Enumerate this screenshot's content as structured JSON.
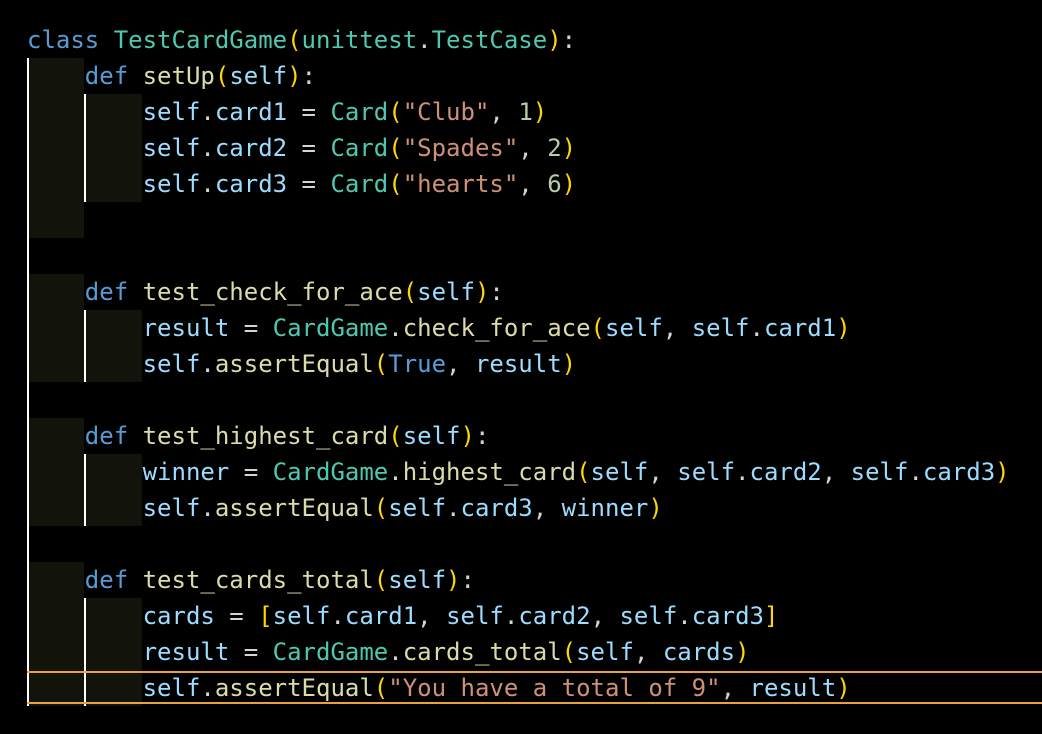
{
  "theme": {
    "background": "#000000",
    "keyword": "#569cd6",
    "class_name": "#4ec9b0",
    "function_name": "#dcdcaa",
    "variable": "#9cdcfe",
    "string": "#ce9178",
    "number": "#b5cea8",
    "bracket_level_1": "#ffd700",
    "bracket_level_2": "#da70d6",
    "bracket_level_3": "#179fff",
    "current_line_border": "#e8a33d",
    "indent_guide": "#ffffff"
  },
  "code": {
    "language": "python",
    "active_line": 20,
    "lines": [
      [
        [
          "class",
          "kw"
        ],
        [
          " ",
          "plain"
        ],
        [
          "TestCardGame",
          "cls"
        ],
        [
          "(",
          "p1"
        ],
        [
          "unittest",
          "cls"
        ],
        [
          ".",
          "plain"
        ],
        [
          "TestCase",
          "cls"
        ],
        [
          ")",
          "p1"
        ],
        [
          ":",
          "plain"
        ]
      ],
      [
        [
          "    ",
          "plain"
        ],
        [
          "def",
          "kw"
        ],
        [
          " ",
          "plain"
        ],
        [
          "setUp",
          "fn"
        ],
        [
          "(",
          "p1"
        ],
        [
          "self",
          "var"
        ],
        [
          ")",
          "p1"
        ],
        [
          ":",
          "plain"
        ]
      ],
      [
        [
          "        ",
          "plain"
        ],
        [
          "self",
          "var"
        ],
        [
          ".",
          "plain"
        ],
        [
          "card1",
          "var"
        ],
        [
          " = ",
          "plain"
        ],
        [
          "Card",
          "cls"
        ],
        [
          "(",
          "p1"
        ],
        [
          "\"Club\"",
          "str"
        ],
        [
          ", ",
          "plain"
        ],
        [
          "1",
          "num"
        ],
        [
          ")",
          "p1"
        ]
      ],
      [
        [
          "        ",
          "plain"
        ],
        [
          "self",
          "var"
        ],
        [
          ".",
          "plain"
        ],
        [
          "card2",
          "var"
        ],
        [
          " = ",
          "plain"
        ],
        [
          "Card",
          "cls"
        ],
        [
          "(",
          "p1"
        ],
        [
          "\"Spades\"",
          "str"
        ],
        [
          ", ",
          "plain"
        ],
        [
          "2",
          "num"
        ],
        [
          ")",
          "p1"
        ]
      ],
      [
        [
          "        ",
          "plain"
        ],
        [
          "self",
          "var"
        ],
        [
          ".",
          "plain"
        ],
        [
          "card3",
          "var"
        ],
        [
          " = ",
          "plain"
        ],
        [
          "Card",
          "cls"
        ],
        [
          "(",
          "p1"
        ],
        [
          "\"hearts\"",
          "str"
        ],
        [
          ", ",
          "plain"
        ],
        [
          "6",
          "num"
        ],
        [
          ")",
          "p1"
        ]
      ],
      [],
      [],
      [
        [
          "    ",
          "plain"
        ],
        [
          "def",
          "kw"
        ],
        [
          " ",
          "plain"
        ],
        [
          "test_check_for_ace",
          "fn"
        ],
        [
          "(",
          "p1"
        ],
        [
          "self",
          "var"
        ],
        [
          ")",
          "p1"
        ],
        [
          ":",
          "plain"
        ]
      ],
      [
        [
          "        ",
          "plain"
        ],
        [
          "result",
          "var"
        ],
        [
          " = ",
          "plain"
        ],
        [
          "CardGame",
          "cls"
        ],
        [
          ".",
          "plain"
        ],
        [
          "check_for_ace",
          "fn"
        ],
        [
          "(",
          "p1"
        ],
        [
          "self",
          "var"
        ],
        [
          ", ",
          "plain"
        ],
        [
          "self",
          "var"
        ],
        [
          ".",
          "plain"
        ],
        [
          "card1",
          "var"
        ],
        [
          ")",
          "p1"
        ]
      ],
      [
        [
          "        ",
          "plain"
        ],
        [
          "self",
          "var"
        ],
        [
          ".",
          "plain"
        ],
        [
          "assertEqual",
          "fn"
        ],
        [
          "(",
          "p1"
        ],
        [
          "True",
          "kw"
        ],
        [
          ", ",
          "plain"
        ],
        [
          "result",
          "var"
        ],
        [
          ")",
          "p1"
        ]
      ],
      [],
      [
        [
          "    ",
          "plain"
        ],
        [
          "def",
          "kw"
        ],
        [
          " ",
          "plain"
        ],
        [
          "test_highest_card",
          "fn"
        ],
        [
          "(",
          "p1"
        ],
        [
          "self",
          "var"
        ],
        [
          ")",
          "p1"
        ],
        [
          ":",
          "plain"
        ]
      ],
      [
        [
          "        ",
          "plain"
        ],
        [
          "winner",
          "var"
        ],
        [
          " = ",
          "plain"
        ],
        [
          "CardGame",
          "cls"
        ],
        [
          ".",
          "plain"
        ],
        [
          "highest_card",
          "fn"
        ],
        [
          "(",
          "p1"
        ],
        [
          "self",
          "var"
        ],
        [
          ", ",
          "plain"
        ],
        [
          "self",
          "var"
        ],
        [
          ".",
          "plain"
        ],
        [
          "card2",
          "var"
        ],
        [
          ", ",
          "plain"
        ],
        [
          "self",
          "var"
        ],
        [
          ".",
          "plain"
        ],
        [
          "card3",
          "var"
        ],
        [
          ")",
          "p1"
        ]
      ],
      [
        [
          "        ",
          "plain"
        ],
        [
          "self",
          "var"
        ],
        [
          ".",
          "plain"
        ],
        [
          "assertEqual",
          "fn"
        ],
        [
          "(",
          "p1"
        ],
        [
          "self",
          "var"
        ],
        [
          ".",
          "plain"
        ],
        [
          "card3",
          "var"
        ],
        [
          ", ",
          "plain"
        ],
        [
          "winner",
          "var"
        ],
        [
          ")",
          "p1"
        ]
      ],
      [],
      [
        [
          "    ",
          "plain"
        ],
        [
          "def",
          "kw"
        ],
        [
          " ",
          "plain"
        ],
        [
          "test_cards_total",
          "fn"
        ],
        [
          "(",
          "p1"
        ],
        [
          "self",
          "var"
        ],
        [
          ")",
          "p1"
        ],
        [
          ":",
          "plain"
        ]
      ],
      [
        [
          "        ",
          "plain"
        ],
        [
          "cards",
          "var"
        ],
        [
          " = ",
          "plain"
        ],
        [
          "[",
          "p1"
        ],
        [
          "self",
          "var"
        ],
        [
          ".",
          "plain"
        ],
        [
          "card1",
          "var"
        ],
        [
          ", ",
          "plain"
        ],
        [
          "self",
          "var"
        ],
        [
          ".",
          "plain"
        ],
        [
          "card2",
          "var"
        ],
        [
          ", ",
          "plain"
        ],
        [
          "self",
          "var"
        ],
        [
          ".",
          "plain"
        ],
        [
          "card3",
          "var"
        ],
        [
          "]",
          "p1"
        ]
      ],
      [
        [
          "        ",
          "plain"
        ],
        [
          "result",
          "var"
        ],
        [
          " = ",
          "plain"
        ],
        [
          "CardGame",
          "cls"
        ],
        [
          ".",
          "plain"
        ],
        [
          "cards_total",
          "fn"
        ],
        [
          "(",
          "p1"
        ],
        [
          "self",
          "var"
        ],
        [
          ", ",
          "plain"
        ],
        [
          "cards",
          "var"
        ],
        [
          ")",
          "p1"
        ]
      ],
      [
        [
          "        ",
          "plain"
        ],
        [
          "self",
          "var"
        ],
        [
          ".",
          "plain"
        ],
        [
          "assertEqual",
          "fn"
        ],
        [
          "(",
          "p1"
        ],
        [
          "\"You have a total of 9\"",
          "str"
        ],
        [
          ", ",
          "plain"
        ],
        [
          "result",
          "var"
        ],
        [
          ")",
          "p1"
        ]
      ]
    ]
  }
}
